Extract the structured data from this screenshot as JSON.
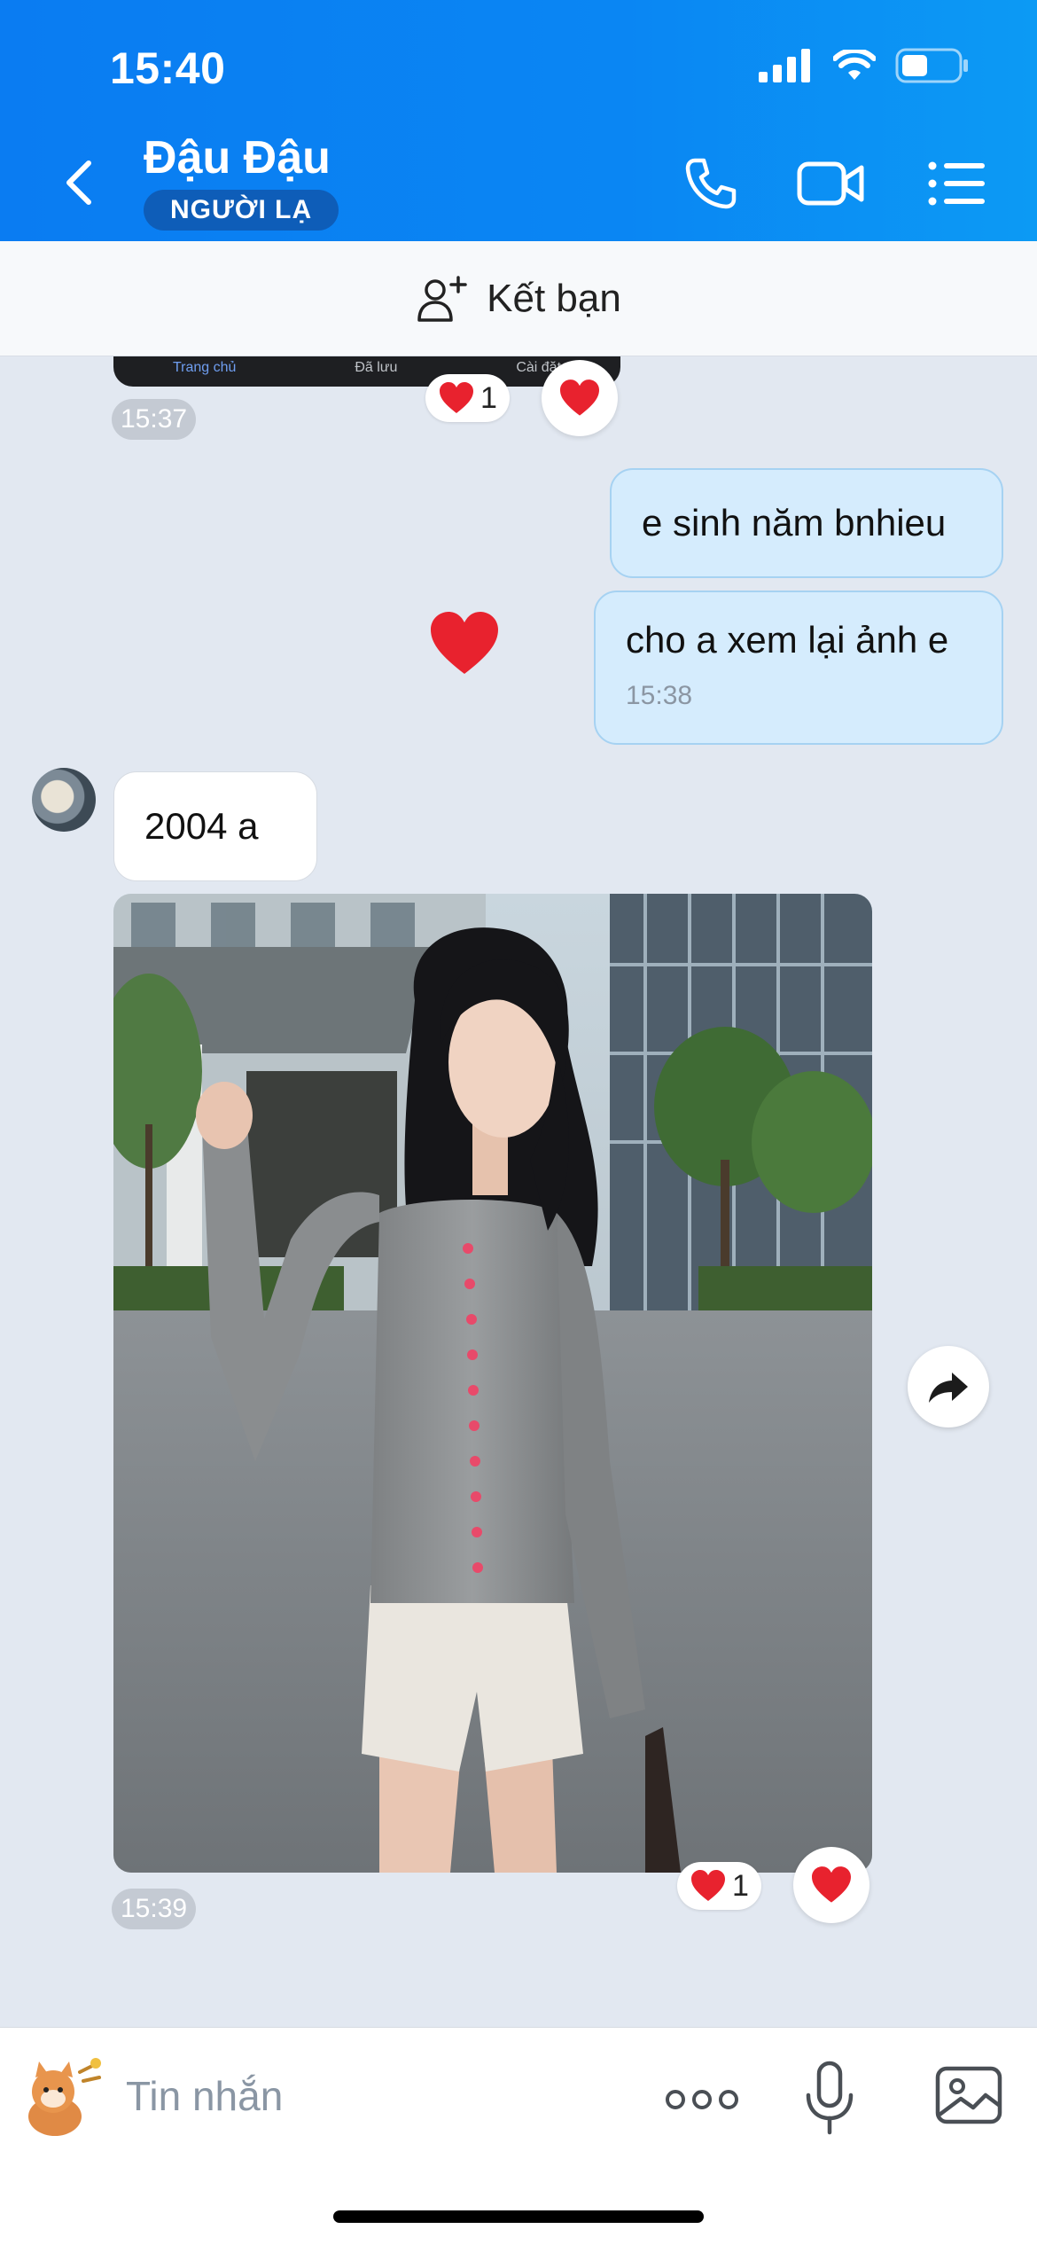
{
  "status_bar": {
    "time": "15:40"
  },
  "header": {
    "title": "Đậu Đậu",
    "badge": "NGƯỜI LẠ"
  },
  "add_friend": {
    "label": "Kết bạn"
  },
  "previous_image_tabs": [
    "Trang chủ",
    "Đã lưu",
    "Cài đặt"
  ],
  "messages": {
    "prev_image_reaction_count": "1",
    "prev_image_time": "15:37",
    "out_1": "e sinh năm bnhieu",
    "out_2": "cho a xem lại ảnh e",
    "out_2_time": "15:38",
    "in_1": "2004 a",
    "photo_reaction_count": "1",
    "photo_time": "15:39"
  },
  "input": {
    "placeholder": "Tin nhắn"
  },
  "colors": {
    "header": "#0a7cf2",
    "chat_bg": "#e2e8f1",
    "out_bubble": "#d5ecfd",
    "heart": "#e8222e"
  },
  "icons": [
    "back-icon",
    "phone-icon",
    "video-icon",
    "menu-icon",
    "add-user-icon",
    "heart-icon",
    "share-icon",
    "sticker-icon",
    "more-icon",
    "mic-icon",
    "gallery-icon"
  ]
}
